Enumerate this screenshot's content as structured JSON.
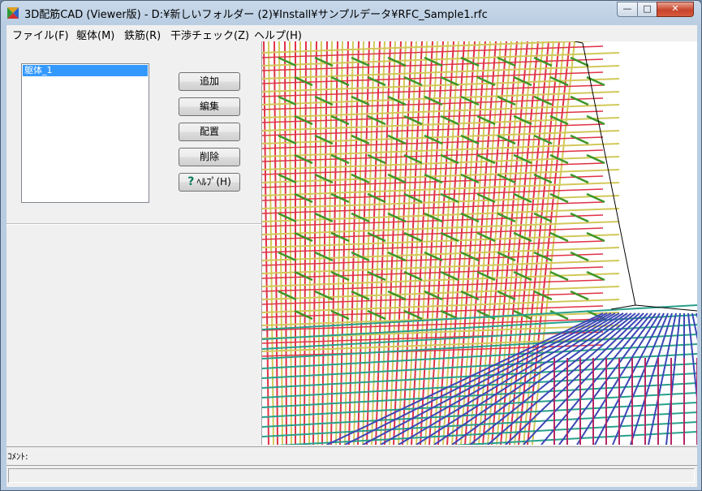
{
  "window": {
    "title": "3D配筋CAD (Viewer版) - D:¥新しいフォルダー (2)¥Install¥サンプルデータ¥RFC_Sample1.rfc",
    "minimize_glyph": "—",
    "maximize_glyph": "□",
    "close_glyph": "✕"
  },
  "menu": {
    "items": [
      {
        "label": "ファイル(F)"
      },
      {
        "label": "躯体(M)"
      },
      {
        "label": "鉄筋(R)"
      },
      {
        "label": "干渉チェック(Z)"
      },
      {
        "label": "ヘルプ(H)"
      }
    ]
  },
  "left_panel": {
    "list_items": [
      "躯体_1"
    ],
    "buttons": {
      "add": "追加",
      "edit": "編集",
      "place": "配置",
      "delete": "削除",
      "help": "ﾍﾙﾌﾟ(H)"
    }
  },
  "comment": {
    "label": "ｺﾒﾝﾄ:"
  },
  "colors": {
    "rebar_red": "#e03246",
    "rebar_yellow": "#d2c85a",
    "rebar_green": "#3c9628",
    "rebar_teal": "#28a08c",
    "rebar_blue": "#3c46b4",
    "rebar_magenta": "#b42864"
  }
}
